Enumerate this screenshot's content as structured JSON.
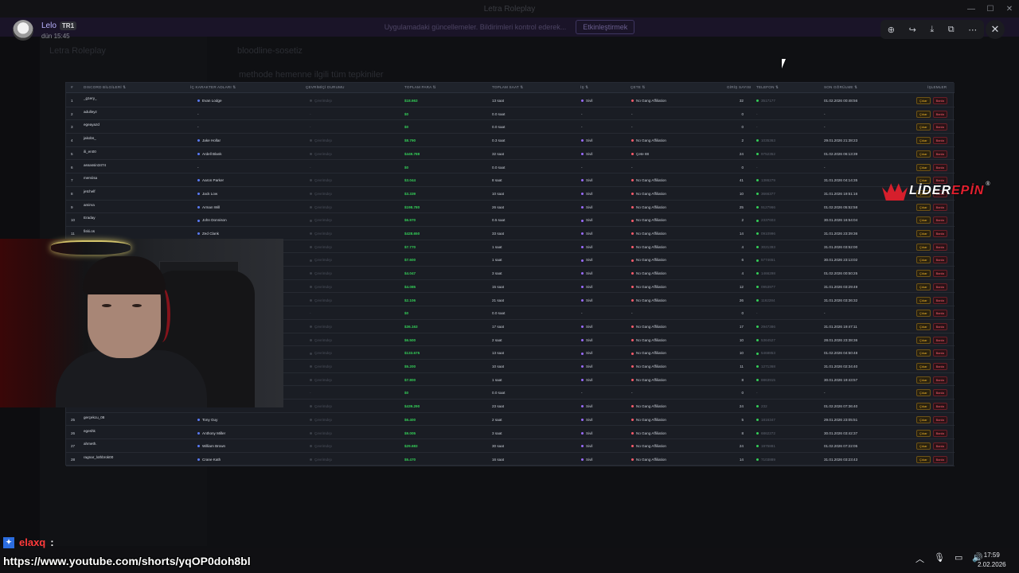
{
  "window": {
    "title": "Letra Roleplay",
    "server_name": "Letra Roleplay",
    "channel_name": "bloodline-sosetiz",
    "channel_topic": "methode hemenne ilgili tüm tepkiniler",
    "banner_text": "Uygulamadaki güncellemeler. Bildirimleri kontrol ederek...",
    "banner_button": "Etkinleştirmek"
  },
  "viewer": {
    "username": "Lelo",
    "tag": "TR1",
    "timestamp": "dün 15:45",
    "tools": [
      "zoom-in-icon",
      "forward-icon",
      "download-icon",
      "open-external-icon",
      "more-icon"
    ],
    "close": "✕"
  },
  "table": {
    "headers": [
      "#",
      "DISCORD BİLGİLERİ ⇅",
      "İÇ KARAKTER ADLARI ⇅",
      "ÇEVRİMİÇİ DURUMU",
      "TOPLAM PARA ⇅",
      "TOPLAM SAAT ⇅",
      "İŞ ⇅",
      "ÇETE ⇅",
      "GİRİŞ SAYISI",
      "TELEFON ⇅",
      "SON GÖRÜLME ⇅",
      "İŞLEMLER"
    ],
    "action_kick": "Çıkar",
    "action_ban": "Banla",
    "rows": [
      {
        "n": "1",
        "d": "_g1ery_",
        "c": "Evan Lodge",
        "s": "Çevrimdışı",
        "m": "$18.663",
        "h": "13 saat",
        "j": "Sivil",
        "g": "No Gang Affiliation",
        "e": "32",
        "p": "3517177",
        "l": "01.02.2026 00:48:56"
      },
      {
        "n": "2",
        "d": "adulleyz",
        "c": "-",
        "s": "-",
        "m": "$0",
        "h": "0.0 saat",
        "j": "-",
        "g": "-",
        "e": "0",
        "p": "-",
        "l": "-"
      },
      {
        "n": "3",
        "d": "egeayazd",
        "c": "-",
        "s": "-",
        "m": "$0",
        "h": "0.0 saat",
        "j": "-",
        "g": "-",
        "e": "0",
        "p": "-",
        "l": "-"
      },
      {
        "n": "4",
        "d": "jakobs_",
        "c": "Jake Hollar",
        "s": "Çevrimdışı",
        "m": "$8.790",
        "h": "0.3 saat",
        "j": "Sivil",
        "g": "No Gang Affiliation",
        "e": "2",
        "p": "1035363",
        "l": "29.01.2026 21:38:23"
      },
      {
        "n": "5",
        "d": "ili_en00",
        "c": "Ardell Blank",
        "s": "Çevrimdışı",
        "m": "$449.788",
        "h": "32 saat",
        "j": "Sivil",
        "g": "Çete 88",
        "e": "24",
        "p": "9752352",
        "l": "01.02.2026 06:13:39"
      },
      {
        "n": "6",
        "d": "assassin3474",
        "c": "-",
        "s": "-",
        "m": "$0",
        "h": "0.0 saat",
        "j": "-",
        "g": "-",
        "e": "0",
        "p": "-",
        "l": "-"
      },
      {
        "n": "7",
        "d": "merviisa",
        "c": "Aaron Parker",
        "s": "Çevrimdışı",
        "m": "$3.044",
        "h": "8 saat",
        "j": "Sivil",
        "g": "No Gang Affiliation",
        "e": "41",
        "p": "1386279",
        "l": "31.01.2026 04:14:35"
      },
      {
        "n": "8",
        "d": "jetchelf",
        "c": "Jack Low",
        "s": "Çevrimdışı",
        "m": "$3.339",
        "h": "10 saat",
        "j": "Sivil",
        "g": "No Gang Affiliation",
        "e": "10",
        "p": "3666377",
        "l": "31.01.2026 19:51:16"
      },
      {
        "n": "9",
        "d": "amirva",
        "c": "Arman Will",
        "s": "Çevrimdışı",
        "m": "$198.780",
        "h": "26 saat",
        "j": "Sivil",
        "g": "No Gang Affiliation",
        "e": "25",
        "p": "9127966",
        "l": "01.02.2026 05:52:58"
      },
      {
        "n": "10",
        "d": "Eraday",
        "c": "John Donnison",
        "s": "Çevrimdışı",
        "m": "$6.970",
        "h": "0.5 saat",
        "j": "Sivil",
        "g": "No Gang Affiliation",
        "e": "2",
        "p": "2337603",
        "l": "30.01.2026 16:54:04"
      },
      {
        "n": "11",
        "d": "fiski.os",
        "c": "Zed Clank",
        "s": "Çevrimdışı",
        "m": "$428.650",
        "h": "33 saat",
        "j": "Sivil",
        "g": "No Gang Affiliation",
        "e": "14",
        "p": "0910996",
        "l": "31.01.2026 23:39:36"
      },
      {
        "n": "12",
        "d": "",
        "c": "",
        "s": "Çevrimdışı",
        "m": "$7.770",
        "h": "1 saat",
        "j": "Sivil",
        "g": "No Gang Affiliation",
        "e": "4",
        "p": "3021393",
        "l": "31.01.2026 03:52:00"
      },
      {
        "n": "13",
        "d": "",
        "c": "",
        "s": "Çevrimdışı",
        "m": "$7.600",
        "h": "1 saat",
        "j": "Sivil",
        "g": "No Gang Affiliation",
        "e": "6",
        "p": "5774651",
        "l": "30.01.2026 23:13:02"
      },
      {
        "n": "14",
        "d": "",
        "c": "",
        "s": "Çevrimdışı",
        "m": "$4.047",
        "h": "3 saat",
        "j": "Sivil",
        "g": "No Gang Affiliation",
        "e": "4",
        "p": "1466298",
        "l": "01.02.2026 00:50:25"
      },
      {
        "n": "15",
        "d": "",
        "c": "",
        "s": "Çevrimdışı",
        "m": "$4.085",
        "h": "15 saat",
        "j": "Sivil",
        "g": "No Gang Affiliation",
        "e": "12",
        "p": "0953977",
        "l": "31.01.2026 03:29:49"
      },
      {
        "n": "16",
        "d": "",
        "c": "",
        "s": "Çevrimdışı",
        "m": "$2.106",
        "h": "21 saat",
        "j": "Sivil",
        "g": "No Gang Affiliation",
        "e": "26",
        "p": "1162284",
        "l": "31.01.2026 03:36:32"
      },
      {
        "n": "17",
        "d": "",
        "c": "",
        "s": "-",
        "m": "$0",
        "h": "0.0 saat",
        "j": "-",
        "g": "-",
        "e": "0",
        "p": "-",
        "l": "-"
      },
      {
        "n": "18",
        "d": "",
        "c": "",
        "s": "Çevrimdışı",
        "m": "$36.163",
        "h": "17 saat",
        "j": "Sivil",
        "g": "No Gang Affiliation",
        "e": "17",
        "p": "2947386",
        "l": "31.01.2026 19:47:11"
      },
      {
        "n": "19",
        "d": "",
        "c": "",
        "s": "Çevrimdışı",
        "m": "$6.500",
        "h": "2 saat",
        "j": "Sivil",
        "g": "No Gang Affiliation",
        "e": "10",
        "p": "5364527",
        "l": "28.01.2026 23:38:36"
      },
      {
        "n": "20",
        "d": "",
        "c": "",
        "s": "Çevrimdışı",
        "m": "$133.675",
        "h": "13 saat",
        "j": "Sivil",
        "g": "No Gang Affiliation",
        "e": "10",
        "p": "5468853",
        "l": "01.02.2026 04:50:48"
      },
      {
        "n": "21",
        "d": "",
        "c": "",
        "s": "Çevrimdışı",
        "m": "$5.200",
        "h": "10 saat",
        "j": "Sivil",
        "g": "No Gang Affiliation",
        "e": "11",
        "p": "1271368",
        "l": "31.01.2026 02:34:40"
      },
      {
        "n": "22",
        "d": "",
        "c": "",
        "s": "Çevrimdışı",
        "m": "$7.800",
        "h": "1 saat",
        "j": "Sivil",
        "g": "No Gang Affiliation",
        "e": "8",
        "p": "8863915",
        "l": "30.01.2026 19:43:57"
      },
      {
        "n": "23",
        "d": "",
        "c": "",
        "s": "-",
        "m": "$0",
        "h": "0.0 saat",
        "j": "-",
        "g": "-",
        "e": "0",
        "p": "-",
        "l": "-"
      },
      {
        "n": "24",
        "d": "",
        "c": "",
        "s": "Çevrimdışı",
        "m": "$439.290",
        "h": "23 saat",
        "j": "Sivil",
        "g": "No Gang Affiliation",
        "e": "24",
        "p": "232",
        "l": "01.02.2026 07:36:40"
      },
      {
        "n": "25",
        "d": "gerçekcu_08",
        "c": "Tony Guy",
        "s": "Çevrimdışı",
        "m": "$6.400",
        "h": "2 saat",
        "j": "Sivil",
        "g": "No Gang Affiliation",
        "e": "5",
        "p": "1816347",
        "l": "29.01.2026 23:05:51"
      },
      {
        "n": "26",
        "d": "egeshk",
        "c": "Anthony Miller",
        "s": "Çevrimdışı",
        "m": "$9.005",
        "h": "3 saat",
        "j": "Sivil",
        "g": "No Gang Affiliation",
        "e": "8",
        "p": "6862272",
        "l": "30.01.2026 03:42:37"
      },
      {
        "n": "27",
        "d": "ahmeth.",
        "c": "William Brown",
        "s": "Çevrimdışı",
        "m": "$29.683",
        "h": "30 saat",
        "j": "Sivil",
        "g": "No Gang Affiliation",
        "e": "24",
        "p": "1975881",
        "l": "01.02.2026 07:22:05"
      },
      {
        "n": "28",
        "d": "ragnar_lothbrok00",
        "c": "Crane Kath",
        "s": "Çevrimdışı",
        "m": "$5.470",
        "h": "16 saat",
        "j": "Sivil",
        "g": "No Gang Affiliation",
        "e": "14",
        "p": "7103889",
        "l": "31.01.2026 03:23:43"
      }
    ]
  },
  "logo": {
    "text_a": "LİDER",
    "text_b": "EPİN",
    "reg": "®"
  },
  "chat": {
    "username": "elaxq",
    "separator": ":"
  },
  "overlay_url": "https://www.youtube.com/shorts/yqOP0doh8bl",
  "clock": {
    "time": "17:59",
    "date": "2.02.2026"
  },
  "colors": {
    "money": "#34d058",
    "kick": "#f0b429",
    "ban": "#ff5c6c",
    "brand_red": "#e2202f"
  }
}
